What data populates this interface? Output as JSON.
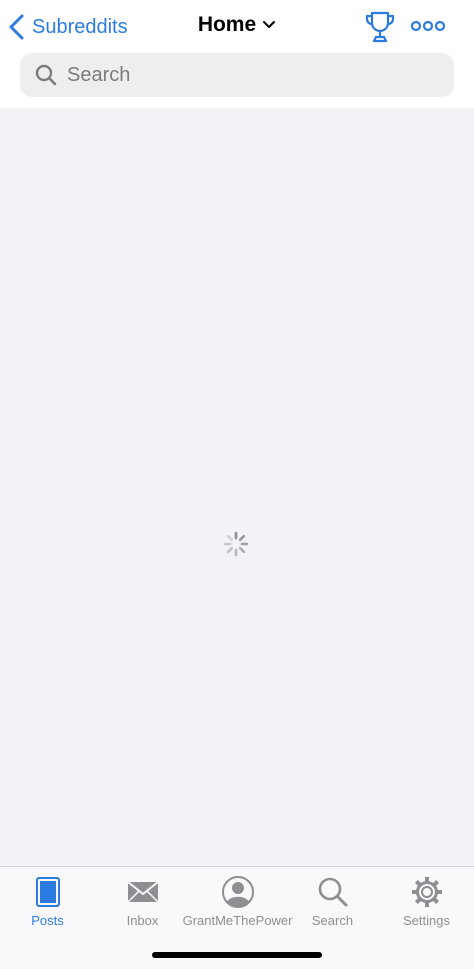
{
  "colors": {
    "accent": "#2d7be0",
    "inactive": "#8e8e93",
    "background": "#f2f3f7"
  },
  "nav": {
    "back_label": "Subreddits",
    "title": "Home",
    "trophy_icon": "trophy-icon",
    "more_icon": "ellipsis-icon"
  },
  "search": {
    "placeholder": "Search"
  },
  "content": {
    "state": "loading",
    "spinner_icon": "activity-spinner-icon"
  },
  "tabbar": {
    "tabs": [
      {
        "label": "Posts",
        "icon": "posts-icon",
        "active": true
      },
      {
        "label": "Inbox",
        "icon": "envelope-icon",
        "active": false
      },
      {
        "label": "GrantMeThePower",
        "icon": "account-icon",
        "active": false
      },
      {
        "label": "Search",
        "icon": "magnifier-icon",
        "active": false
      },
      {
        "label": "Settings",
        "icon": "gear-icon",
        "active": false
      }
    ]
  }
}
